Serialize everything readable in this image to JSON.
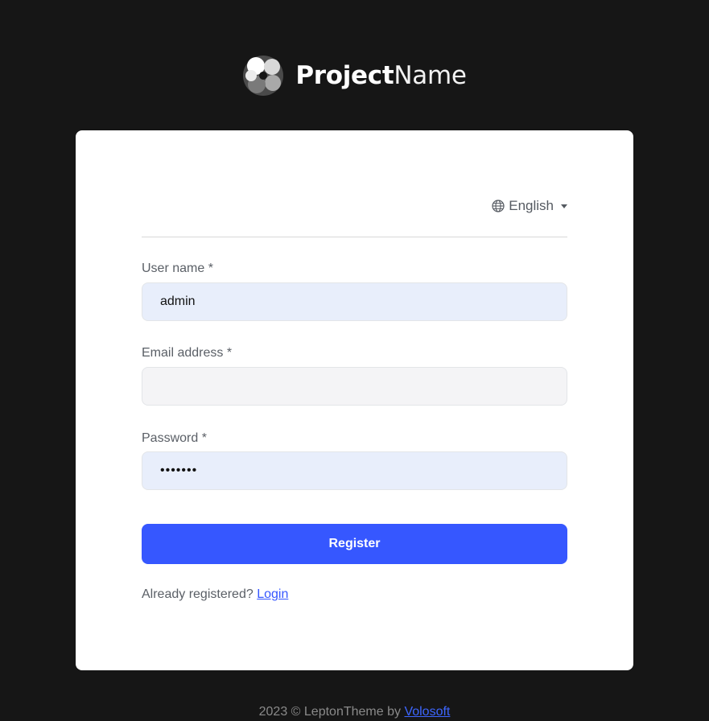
{
  "brand": {
    "name_bold": "Project",
    "name_light": "Name"
  },
  "language": {
    "label": "English",
    "icon": "globe-icon"
  },
  "form": {
    "username": {
      "label": "User name *",
      "value": "admin"
    },
    "email": {
      "label": "Email address *",
      "value": ""
    },
    "password": {
      "label": "Password *",
      "value": "•••••••"
    },
    "register_label": "Register",
    "already_text": "Already registered?",
    "login_label": "Login"
  },
  "footer": {
    "text": "2023 © LeptonTheme by",
    "link_label": "Volosoft"
  },
  "colors": {
    "background": "#161616",
    "accent": "#3657ff",
    "input_filled": "#e8eefb",
    "input_empty": "#f4f4f6"
  }
}
